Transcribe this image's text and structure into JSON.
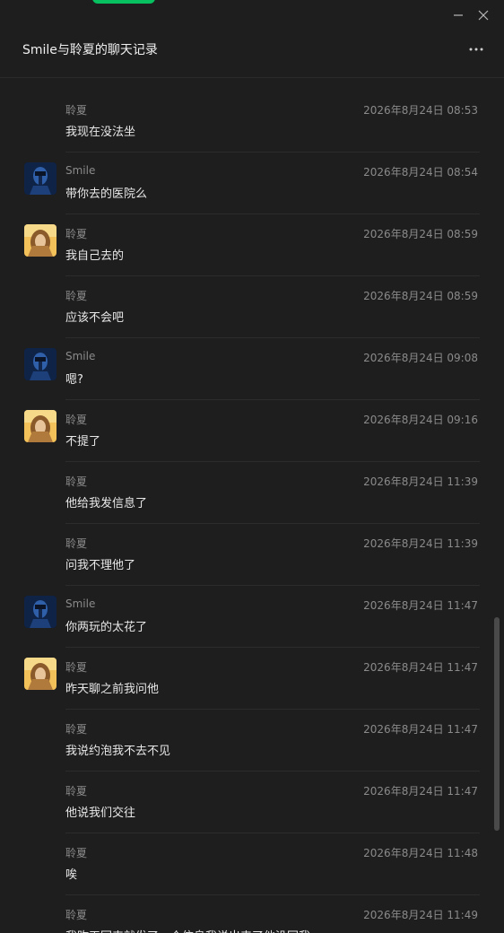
{
  "window": {
    "title": "Smile与聆夏的聊天记录",
    "minimize_icon": "minimize-icon",
    "close_icon": "close-icon",
    "more_icon": "more-options-icon"
  },
  "colors": {
    "background": "#1e1e1e",
    "accent": "#07c160",
    "meta_text": "#8a8a8a",
    "message_text": "#e8e8e8"
  },
  "messages": [
    {
      "sender": "聆夏",
      "time": "2026年8月24日 08:53",
      "text": "我现在没法坐",
      "avatar": ""
    },
    {
      "sender": "Smile",
      "time": "2026年8月24日 08:54",
      "text": "带你去的医院么",
      "avatar": "smile"
    },
    {
      "sender": "聆夏",
      "time": "2026年8月24日 08:59",
      "text": "我自己去的",
      "avatar": "lingxia"
    },
    {
      "sender": "聆夏",
      "time": "2026年8月24日 08:59",
      "text": "应该不会吧",
      "avatar": ""
    },
    {
      "sender": "Smile",
      "time": "2026年8月24日 09:08",
      "text": "嗯?",
      "avatar": "smile"
    },
    {
      "sender": "聆夏",
      "time": "2026年8月24日 09:16",
      "text": "不提了",
      "avatar": "lingxia"
    },
    {
      "sender": "聆夏",
      "time": "2026年8月24日 11:39",
      "text": "他给我发信息了",
      "avatar": ""
    },
    {
      "sender": "聆夏",
      "time": "2026年8月24日 11:39",
      "text": "问我不理他了",
      "avatar": ""
    },
    {
      "sender": "Smile",
      "time": "2026年8月24日 11:47",
      "text": "你两玩的太花了",
      "avatar": "smile"
    },
    {
      "sender": "聆夏",
      "time": "2026年8月24日 11:47",
      "text": "昨天聊之前我问他",
      "avatar": "lingxia"
    },
    {
      "sender": "聆夏",
      "time": "2026年8月24日 11:47",
      "text": "我说约泡我不去不见",
      "avatar": ""
    },
    {
      "sender": "聆夏",
      "time": "2026年8月24日 11:47",
      "text": "他说我们交往",
      "avatar": ""
    },
    {
      "sender": "聆夏",
      "time": "2026年8月24日 11:48",
      "text": "唉",
      "avatar": ""
    },
    {
      "sender": "聆夏",
      "time": "2026年8月24日 11:49",
      "text": "我昨天回来就发了一个信息我说出来了他没回我",
      "avatar": ""
    }
  ]
}
